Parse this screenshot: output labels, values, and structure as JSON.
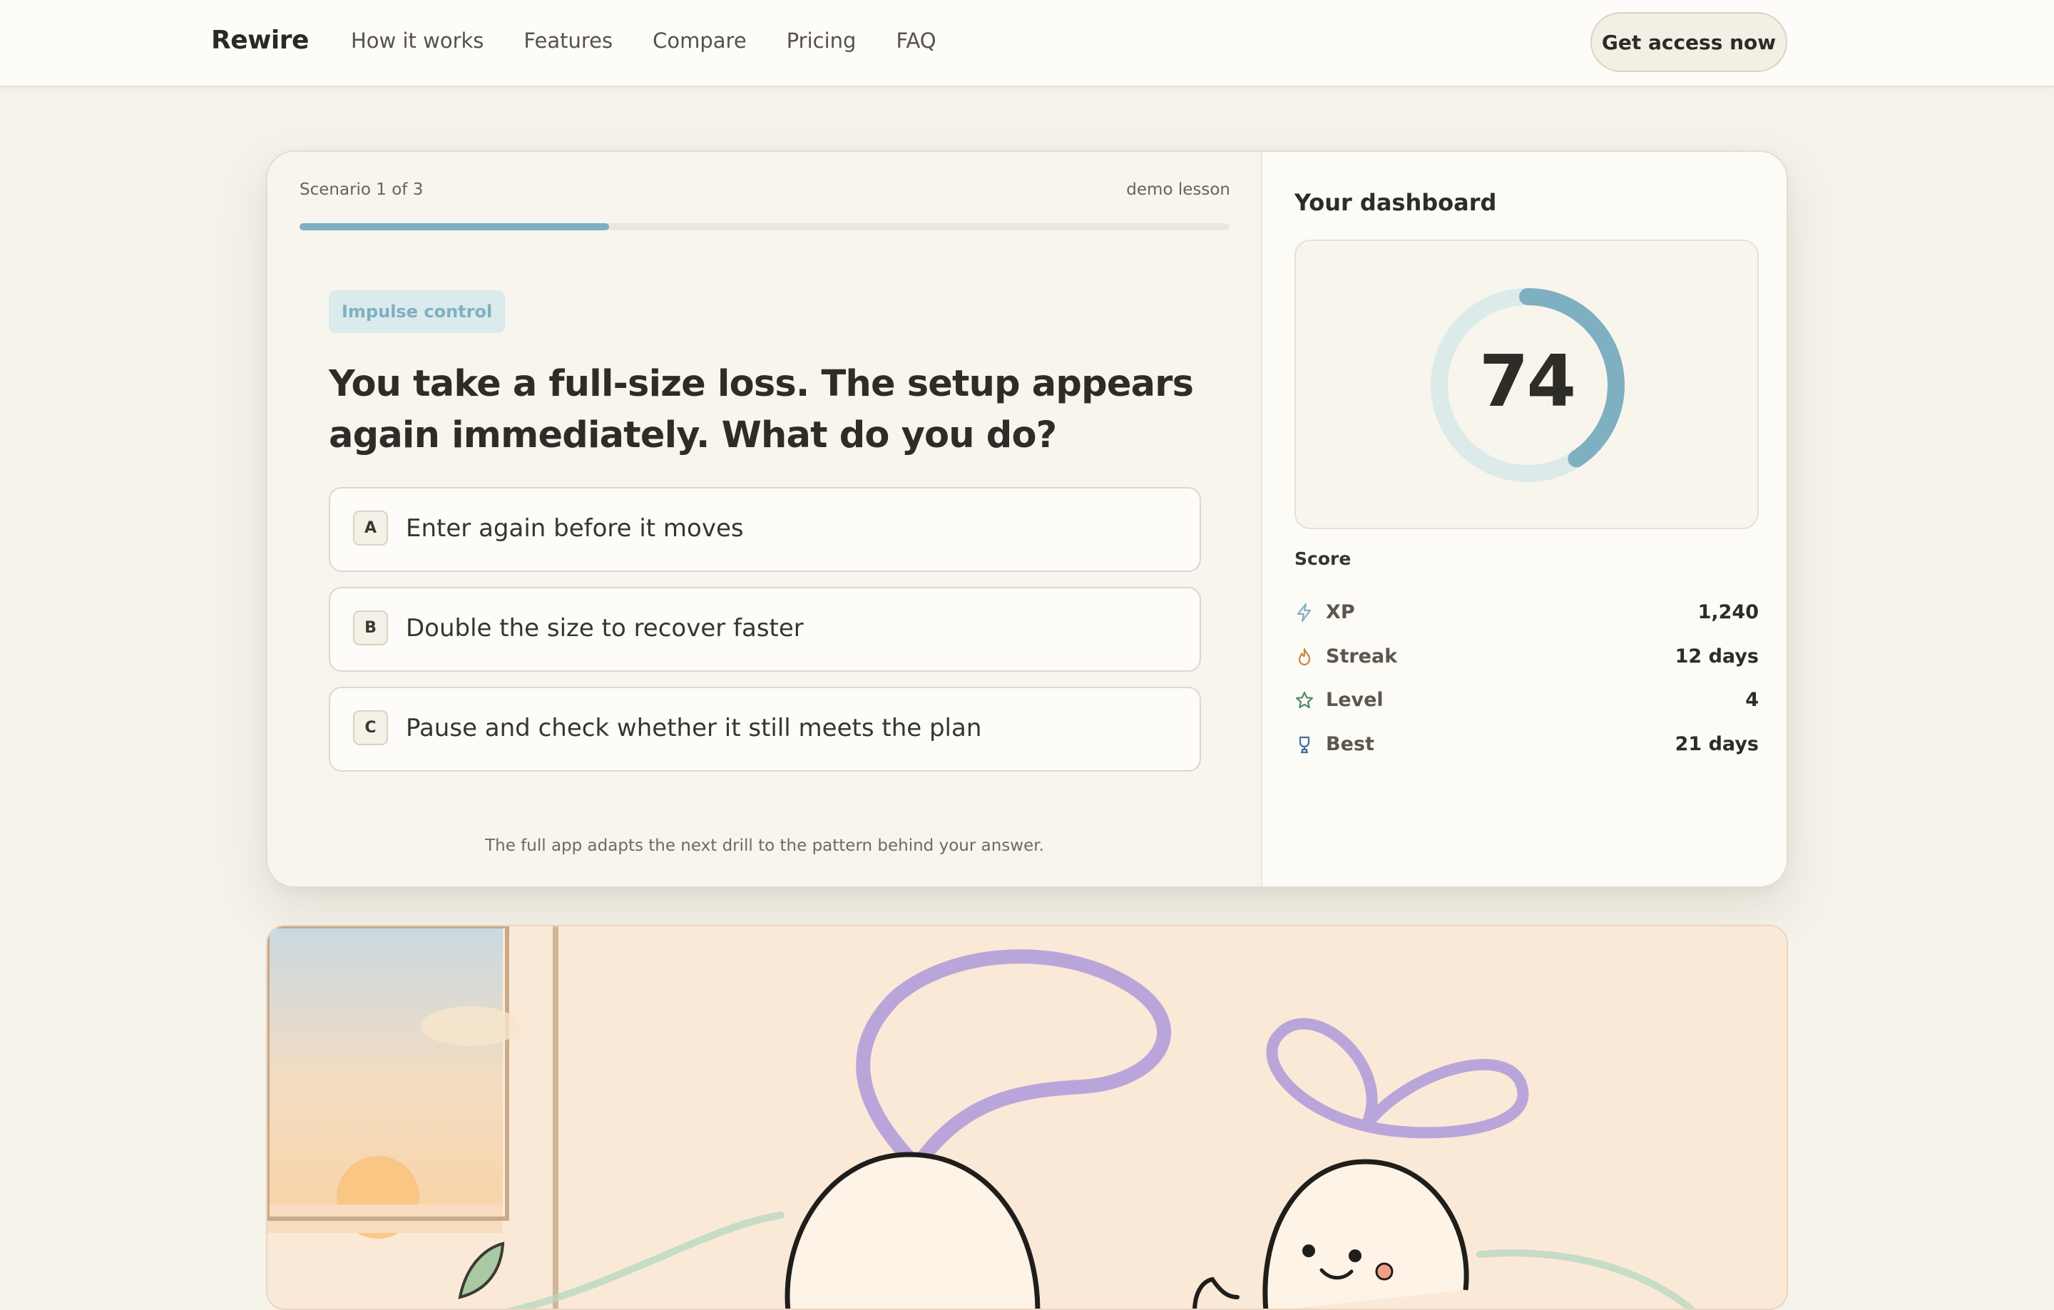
{
  "nav": {
    "brand": "Rewire",
    "links": [
      "How it works",
      "Features",
      "Compare",
      "Pricing",
      "FAQ"
    ],
    "cta": "Get access now"
  },
  "lesson": {
    "scenario": "Scenario 1 of 3",
    "badge": "demo lesson",
    "progress": 0.333,
    "tag": "Impulse control",
    "question": "You take a full-size loss. The setup appears again immediately. What do you do?",
    "options": [
      {
        "key": "A",
        "text": "Enter again before it moves"
      },
      {
        "key": "B",
        "text": "Double the size to recover faster"
      },
      {
        "key": "C",
        "text": "Pause and check whether it still meets the plan"
      }
    ],
    "footnote": "The full app adapts the next drill to the pattern behind your answer."
  },
  "dashboard": {
    "title": "Your dashboard",
    "score": "74",
    "score_fraction": 0.74,
    "score_label": "Score",
    "stats": [
      {
        "icon": "lightning-icon",
        "name": "XP",
        "value": "1,240",
        "color": "#7fb0c2"
      },
      {
        "icon": "flame-icon",
        "name": "Streak",
        "value": "12 days",
        "color": "#c8873a"
      },
      {
        "icon": "star-icon",
        "name": "Level",
        "value": "4",
        "color": "#4f8a6a"
      },
      {
        "icon": "trophy-icon",
        "name": "Best",
        "value": "21 days",
        "color": "#3f6fa0"
      }
    ]
  },
  "colors": {
    "accent": "#7fb0c2",
    "gauge_track": "#dcebea",
    "background": "#f5f2ea"
  }
}
